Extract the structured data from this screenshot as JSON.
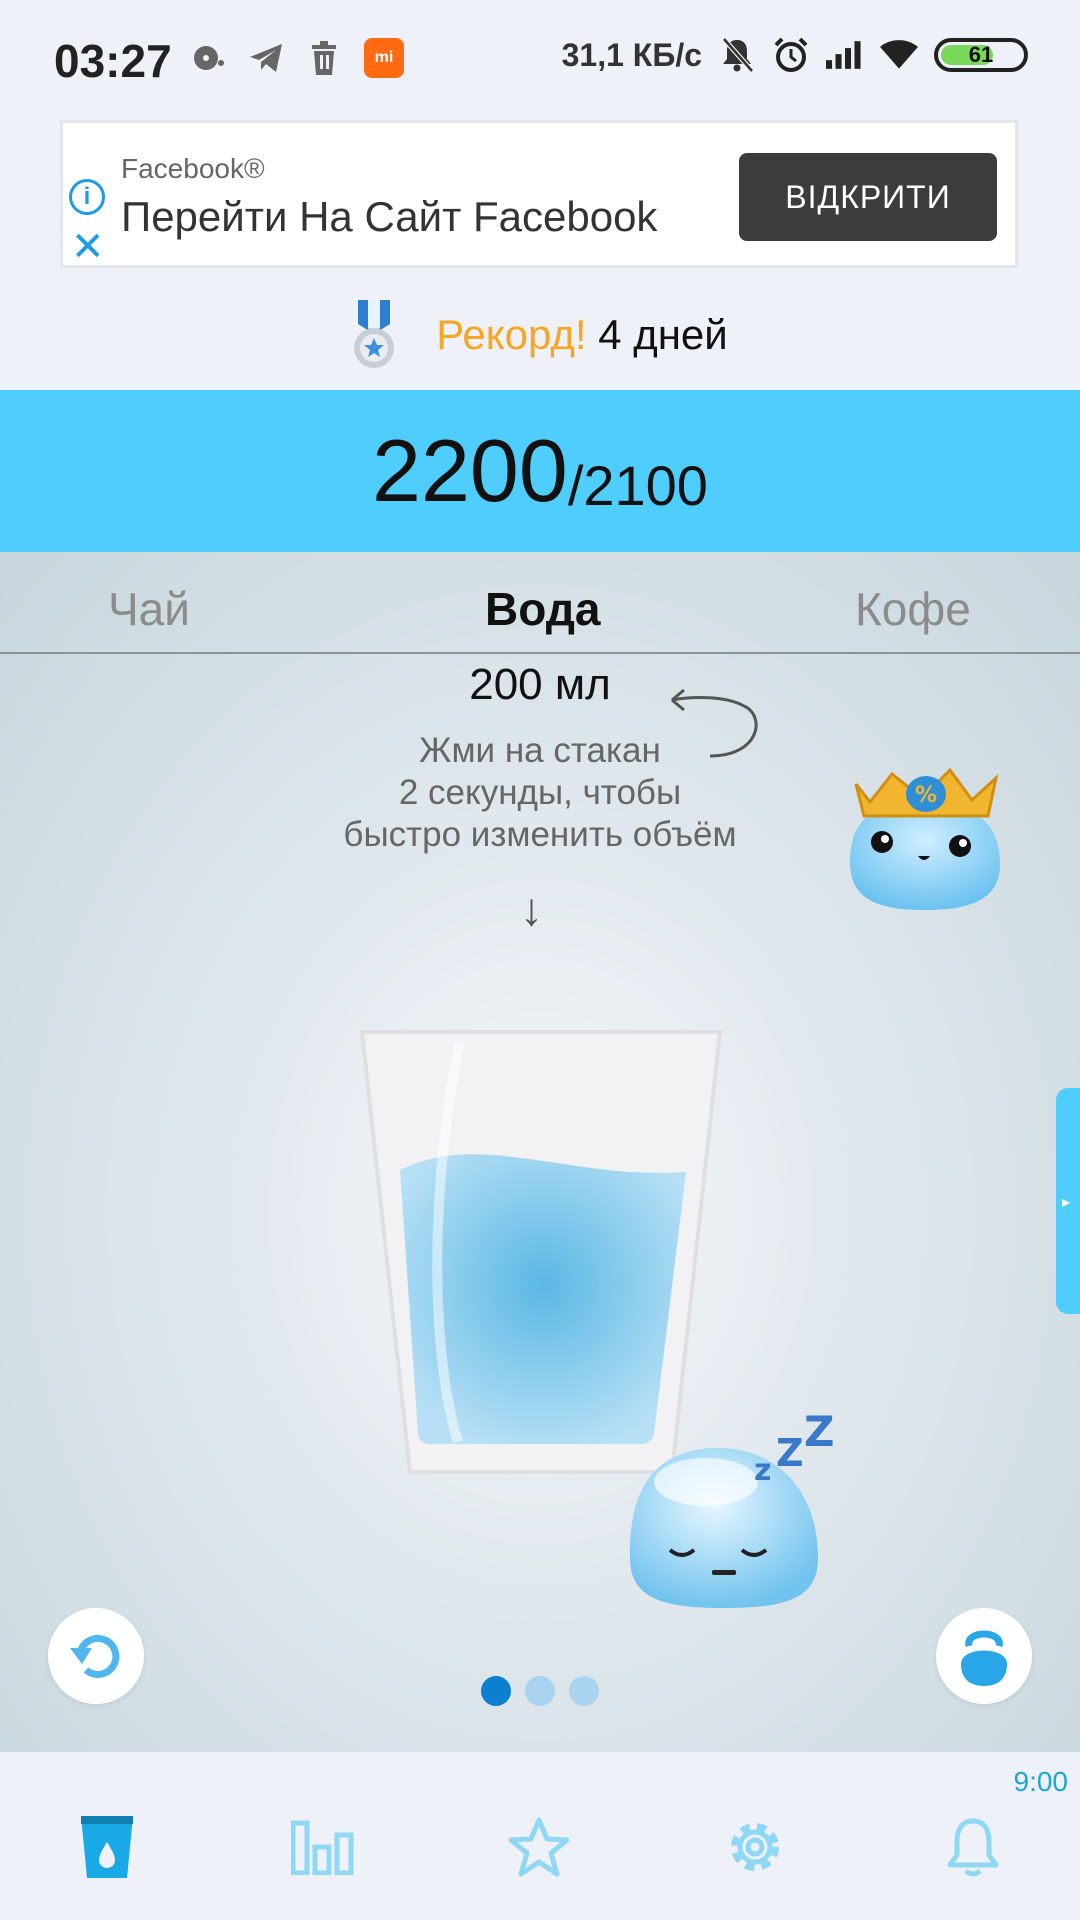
{
  "status_bar": {
    "time": "03:27",
    "net_speed": "31,1 КБ/с",
    "battery": "61",
    "mi_badge": "mi",
    "left_icons": [
      "record-icon",
      "telegram-icon",
      "trash-icon",
      "mi-home-icon"
    ],
    "right_icons": [
      "mute-icon",
      "alarm-icon",
      "signal-icon",
      "wifi-icon",
      "battery-icon"
    ]
  },
  "ad": {
    "brand": "Facebook®",
    "title": "Перейти На Сайт Facebook",
    "button": "ВІДКРИТИ",
    "info_glyph": "i",
    "close_glyph": "✕"
  },
  "record": {
    "word": "Рекорд!",
    "days": "4 дней"
  },
  "total": {
    "current": "2200",
    "goal": "/2100"
  },
  "tabs": [
    {
      "label": "Чай"
    },
    {
      "label": "Вода"
    },
    {
      "label": "Кофе"
    }
  ],
  "volume": "200 мл",
  "hint": [
    "Жми на стакан",
    "2 секунды, чтобы",
    "быстро изменить объём"
  ],
  "arrow": "↓",
  "side_tab_glyph": "▸",
  "alarm_time": "9:00",
  "colors": {
    "accent": "#4fcdfc",
    "record": "#f5a623",
    "nav_active": "#19a9e6",
    "nav_inactive": "#8fd8f5"
  },
  "nav": [
    "glass-icon",
    "chart-icon",
    "star-icon",
    "gear-icon",
    "bell-icon"
  ]
}
